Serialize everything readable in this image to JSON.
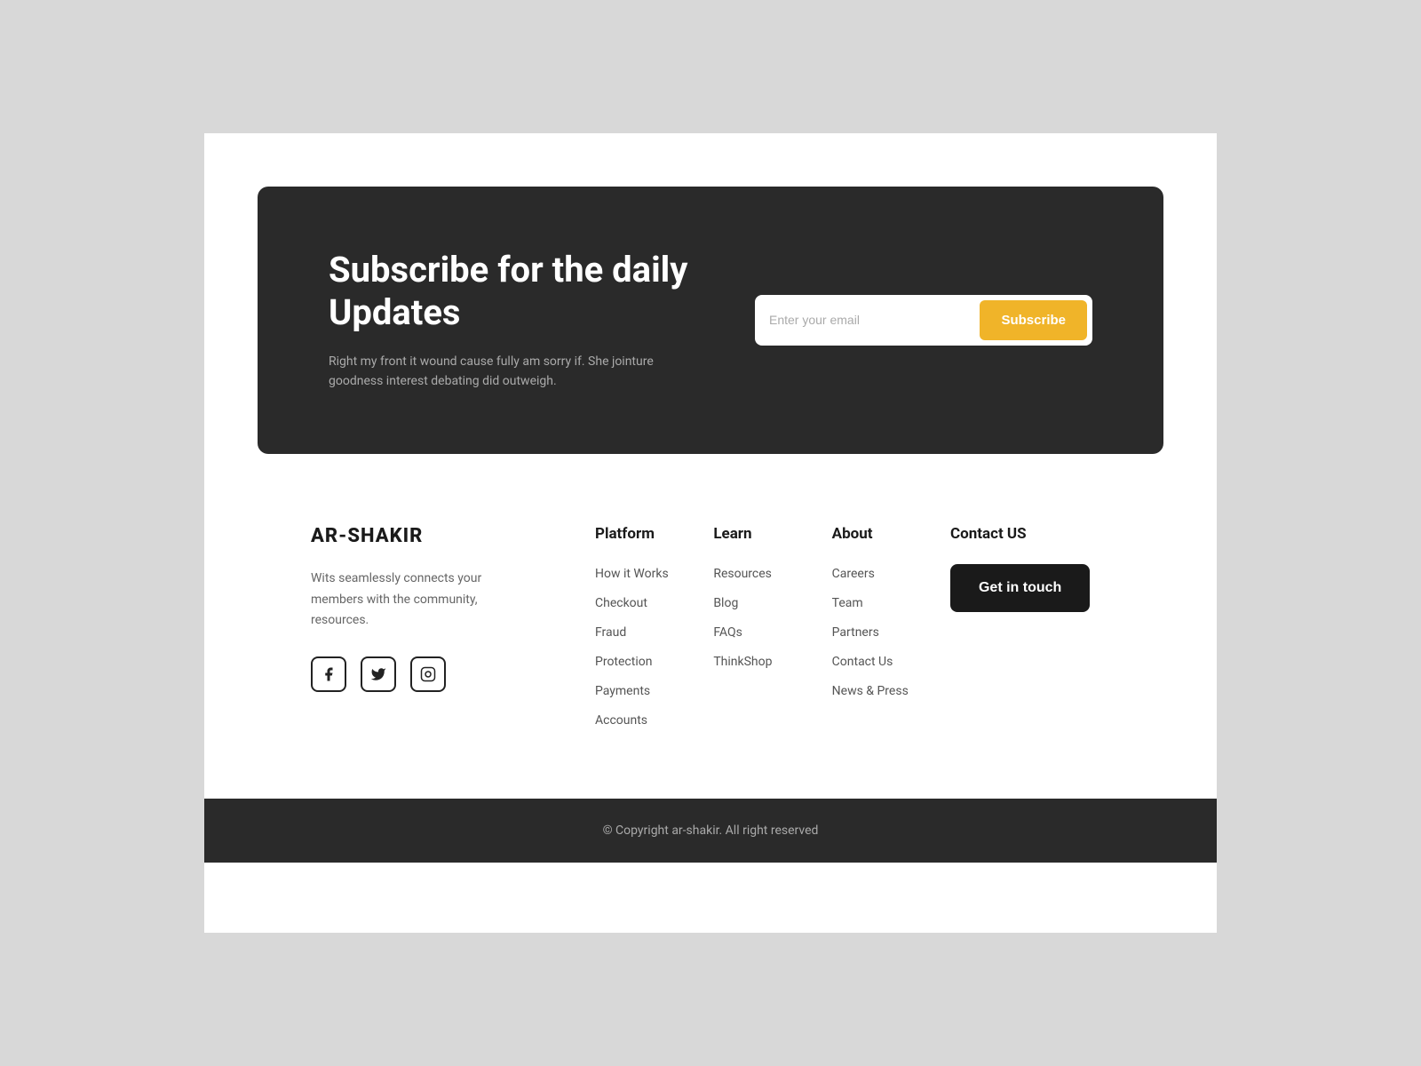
{
  "subscribe": {
    "title": "Subscribe for the daily Updates",
    "description": "Right my front it wound cause fully am sorry if. She jointure goodness interest debating did outweigh.",
    "email_placeholder": "Enter your email",
    "button_label": "Subscribe"
  },
  "brand": {
    "name": "AR-SHAKIR",
    "description": "Wits seamlessly connects your members with the community, resources."
  },
  "social": {
    "facebook_label": "f",
    "twitter_label": "t",
    "instagram_label": "i"
  },
  "platform": {
    "title": "Platform",
    "links": [
      {
        "label": "How it Works"
      },
      {
        "label": "Checkout"
      },
      {
        "label": "Fraud"
      },
      {
        "label": "Protection"
      },
      {
        "label": "Payments"
      },
      {
        "label": "Accounts"
      }
    ]
  },
  "learn": {
    "title": "Learn",
    "links": [
      {
        "label": "Resources"
      },
      {
        "label": "Blog"
      },
      {
        "label": "FAQs"
      },
      {
        "label": "ThinkShop"
      }
    ]
  },
  "about": {
    "title": "About",
    "links": [
      {
        "label": "Careers"
      },
      {
        "label": "Team"
      },
      {
        "label": "Partners"
      },
      {
        "label": "Contact Us"
      },
      {
        "label": "News & Press"
      }
    ]
  },
  "contact": {
    "title": "Contact US",
    "button_label": "Get in touch"
  },
  "footer_bottom": {
    "copyright": "© Copyright ar-shakir. All right reserved"
  }
}
